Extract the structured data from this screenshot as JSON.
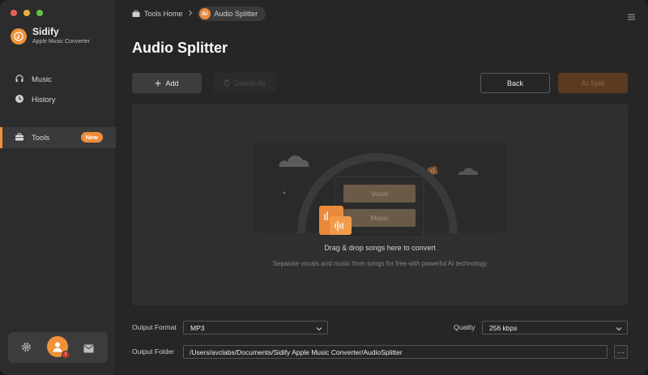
{
  "window": {
    "traffic_lights": [
      "close",
      "minimize",
      "zoom"
    ]
  },
  "brand": {
    "name": "Sidify",
    "subtitle": "Apple Music Converter"
  },
  "sidebar": {
    "items": [
      {
        "label": "Music",
        "icon": "headphones-icon"
      },
      {
        "label": "History",
        "icon": "clock-icon"
      },
      {
        "label": "Tools",
        "icon": "toolbox-icon",
        "badge": "New",
        "active": true
      }
    ],
    "bottom": {
      "settings_icon": "gear-icon",
      "avatar_icon": "user-icon",
      "mail_icon": "mail-icon"
    }
  },
  "breadcrumb": {
    "home": "Tools Home",
    "current": "Audio Splitter",
    "current_badge": "Ai"
  },
  "page": {
    "title": "Audio Splitter"
  },
  "toolbar": {
    "add_label": "Add",
    "delete_label": "Delete All",
    "back_label": "Back",
    "split_label": "AI Split"
  },
  "dropzone": {
    "vocal_label": "Vocal",
    "music_label": "Music",
    "title": "Drag & drop songs here to convert",
    "subtitle": "Separate vocals and music from songs for free with powerful AI technology"
  },
  "output": {
    "format_label": "Output Format",
    "format_value": "MP3",
    "quality_label": "Quality",
    "quality_value": "256 kbps",
    "folder_label": "Output Folder",
    "folder_value": "/Users/avclabs/Documents/Sidify Apple Music Converter/AudioSplitter",
    "more_label": "···"
  },
  "colors": {
    "accent": "#f0913a",
    "sidebar_bg": "#2c2c2c",
    "main_bg": "#262626",
    "drop_bg": "#2f2f2f"
  }
}
